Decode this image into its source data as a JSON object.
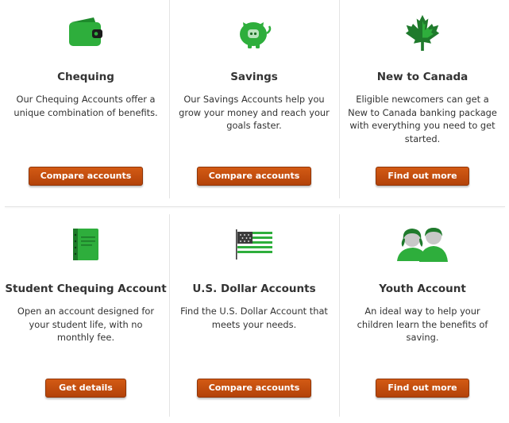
{
  "colors": {
    "accent_green": "#2eae3c",
    "button_orange": "#c44f0e",
    "divider": "#e4e4e4"
  },
  "cards": [
    {
      "icon": "wallet-icon",
      "title": "Chequing",
      "description": "Our Chequing Accounts offer a unique combination of benefits.",
      "button": "Compare accounts"
    },
    {
      "icon": "piggy-bank-icon",
      "title": "Savings",
      "description": "Our Savings Accounts help you grow your money and reach your goals faster.",
      "button": "Compare accounts"
    },
    {
      "icon": "maple-leaf-icon",
      "title": "New to Canada",
      "description": "Eligible newcomers can get a New to Canada banking package with everything you need to get started.",
      "button": "Find out more"
    },
    {
      "icon": "notebook-icon",
      "title": "Student Chequing Account",
      "description": "Open an account designed for your student life, with no monthly fee.",
      "button": "Get details"
    },
    {
      "icon": "us-flag-icon",
      "title": "U.S. Dollar Accounts",
      "description": "Find the U.S. Dollar Account that meets your needs.",
      "button": "Compare accounts"
    },
    {
      "icon": "kids-icon",
      "title": "Youth Account",
      "description": "An ideal way to help your children learn the benefits of saving.",
      "button": "Find out more"
    }
  ]
}
